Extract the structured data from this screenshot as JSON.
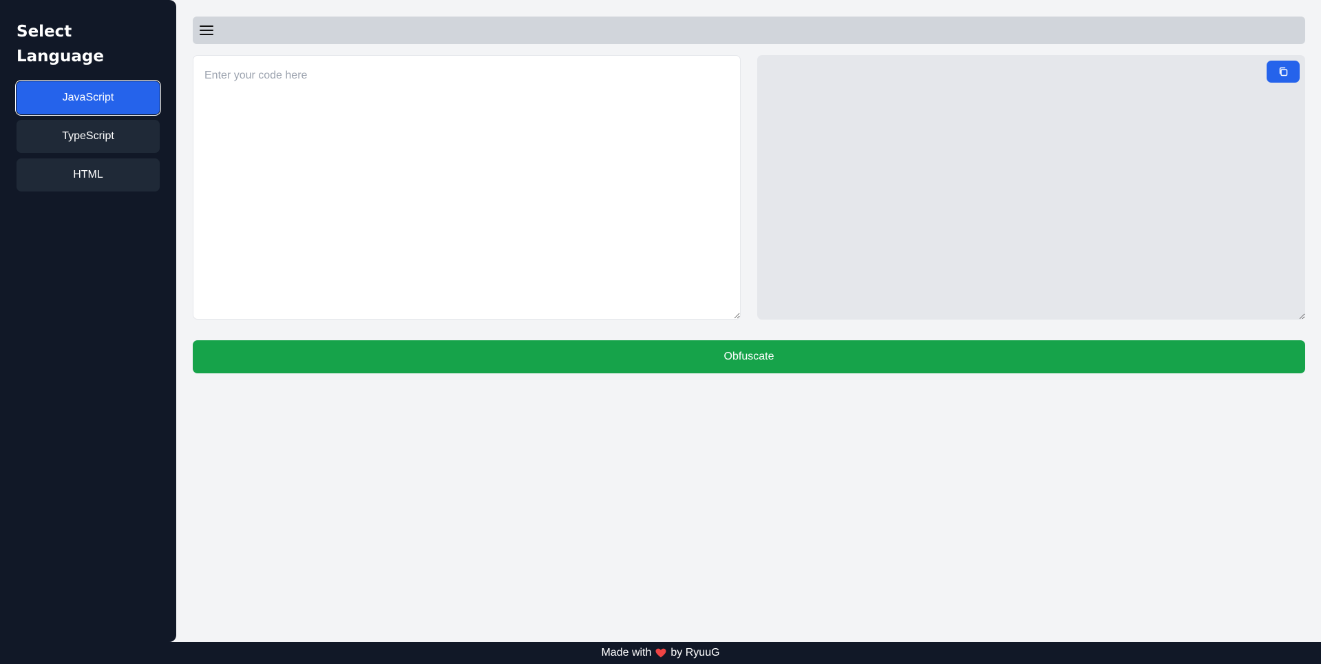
{
  "sidebar": {
    "title": "Select Language",
    "languages": [
      {
        "label": "JavaScript",
        "active": true
      },
      {
        "label": "TypeScript",
        "active": false
      },
      {
        "label": "HTML",
        "active": false
      }
    ]
  },
  "topbar": {
    "menu_icon": "hamburger-menu-icon"
  },
  "editor": {
    "input_value": "",
    "input_placeholder": "Enter your code here",
    "output_value": "",
    "copy_icon": "copy-icon"
  },
  "actions": {
    "obfuscate_label": "Obfuscate"
  },
  "footer": {
    "prefix": "Made with",
    "heart_icon": "heart-icon",
    "suffix": "by RyuuG"
  },
  "colors": {
    "sidebar_bg": "#111827",
    "active_language": "#2563eb",
    "inactive_language": "#1f2937",
    "obfuscate_button": "#16a34a",
    "copy_button": "#2563eb",
    "heart": "#ef4444"
  }
}
